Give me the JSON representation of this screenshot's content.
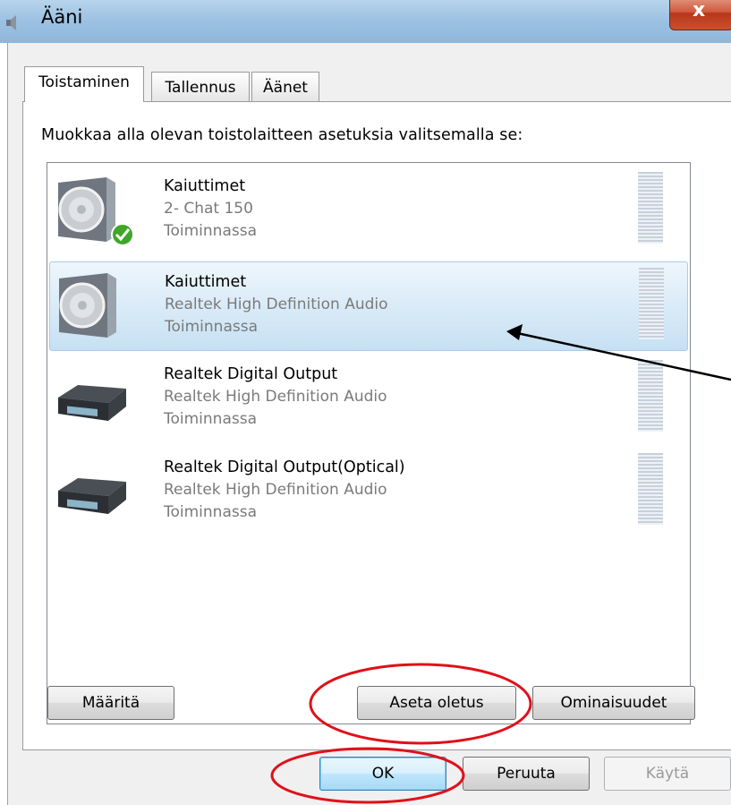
{
  "window": {
    "title": "Ääni",
    "close_label": "x"
  },
  "tabs": [
    {
      "label": "Toistaminen",
      "active": true
    },
    {
      "label": "Tallennus",
      "active": false
    },
    {
      "label": "Äänet",
      "active": false
    }
  ],
  "instruction": "Muokkaa alla olevan toistolaitteen asetuksia valitsemalla se:",
  "devices": [
    {
      "name": "Kaiuttimet",
      "description": "2- Chat 150",
      "status": "Toiminnassa",
      "icon": "speaker-icon",
      "default": true,
      "selected": false
    },
    {
      "name": "Kaiuttimet",
      "description": "Realtek High Definition Audio",
      "status": "Toiminnassa",
      "icon": "speaker-icon",
      "default": false,
      "selected": true
    },
    {
      "name": "Realtek Digital Output",
      "description": "Realtek High Definition Audio",
      "status": "Toiminnassa",
      "icon": "receiver-icon",
      "default": false,
      "selected": false
    },
    {
      "name": "Realtek Digital Output(Optical)",
      "description": "Realtek High Definition Audio",
      "status": "Toiminnassa",
      "icon": "receiver-icon",
      "default": false,
      "selected": false
    }
  ],
  "list_buttons": {
    "configure": "Määritä",
    "set_default": "Aseta oletus",
    "properties": "Ominaisuudet"
  },
  "dialog_buttons": {
    "ok": "OK",
    "cancel": "Peruuta",
    "apply": "Käytä"
  },
  "colors": {
    "annotation": "#e0101a",
    "selection": "#d8eaf7",
    "titlebar": "#9dc2e3"
  }
}
